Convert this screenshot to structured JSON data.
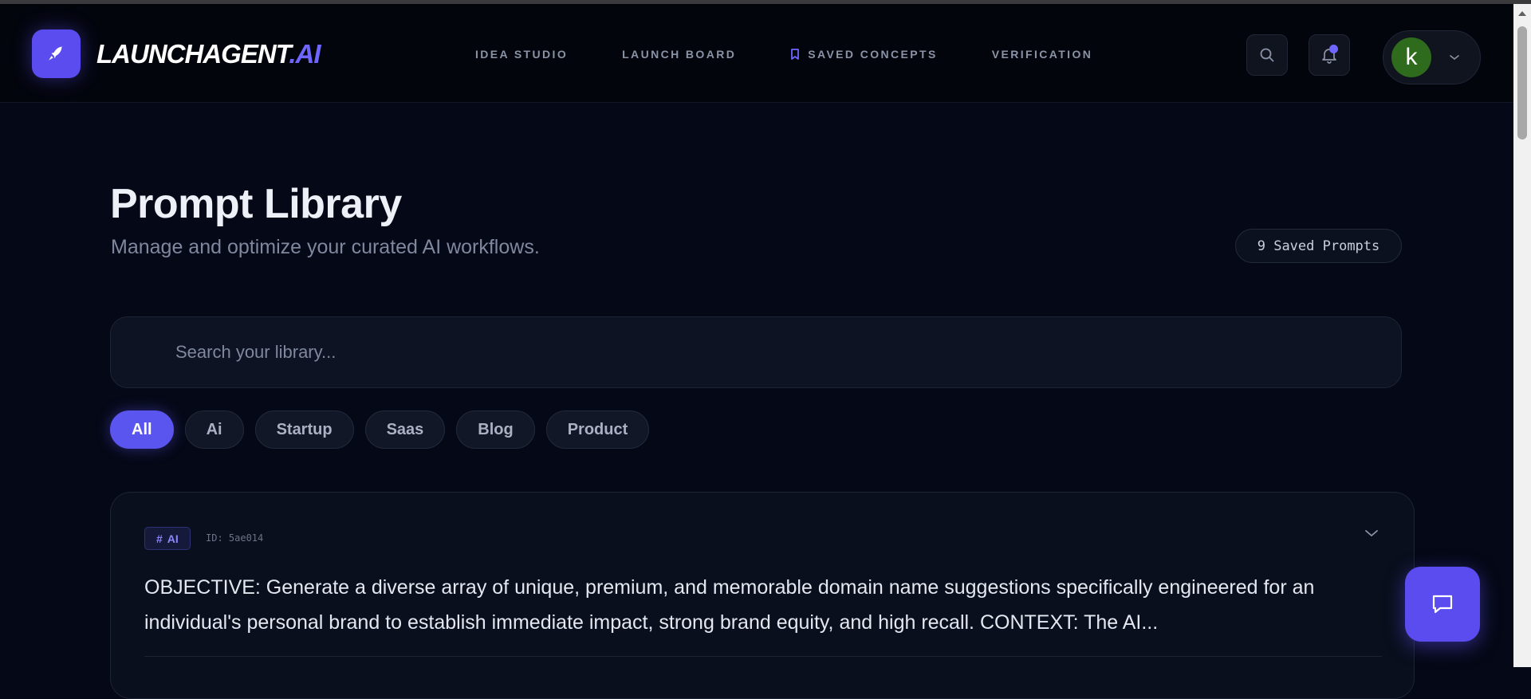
{
  "brand": {
    "name": "LAUNCHAGENT",
    "suffix": ".AI"
  },
  "nav": {
    "items": [
      {
        "label": "IDEA STUDIO"
      },
      {
        "label": "LAUNCH BOARD"
      },
      {
        "label": "SAVED CONCEPTS",
        "icon": "bookmark-icon",
        "active": true
      },
      {
        "label": "VERIFICATION"
      }
    ]
  },
  "user": {
    "initial": "k",
    "avatar_color": "#2f6b1c"
  },
  "page": {
    "title": "Prompt Library",
    "subtitle": "Manage and optimize your curated AI workflows.",
    "count_label": "9 Saved Prompts"
  },
  "search": {
    "placeholder": "Search your library...",
    "value": ""
  },
  "filters": [
    "All",
    "Ai",
    "Startup",
    "Saas",
    "Blog",
    "Product"
  ],
  "active_filter": "All",
  "prompts": [
    {
      "tag": "AI",
      "id_label": "ID: 5ae014",
      "text": "OBJECTIVE: Generate a diverse array of unique, premium, and memorable domain name suggestions specifically engineered for an individual's personal brand to establish immediate impact, strong brand equity, and high recall. CONTEXT: The AI..."
    }
  ],
  "colors": {
    "accent": "#5b4cf0",
    "background": "#050816"
  }
}
